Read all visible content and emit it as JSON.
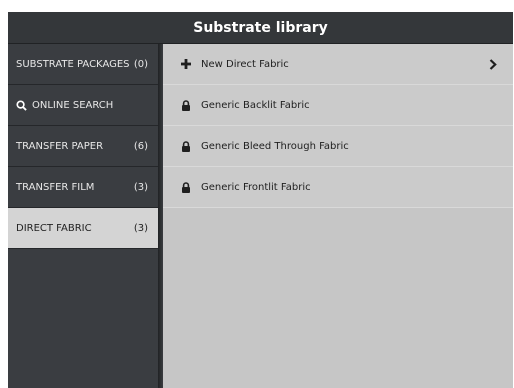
{
  "header": {
    "title": "Substrate library"
  },
  "sidebar": {
    "items": [
      {
        "label": "SUBSTRATE PACKAGES",
        "count": "(0)"
      },
      {
        "label": "ONLINE SEARCH",
        "icon": "search-icon",
        "count": ""
      },
      {
        "label": "TRANSFER PAPER",
        "count": "(6)"
      },
      {
        "label": "TRANSFER FILM",
        "count": "(3)"
      },
      {
        "label": "DIRECT FABRIC",
        "count": "(3)",
        "selected": true
      }
    ],
    "accent_color": "#1e9bdc"
  },
  "list": {
    "items": [
      {
        "label": "New Direct Fabric",
        "icon": "plus-icon",
        "trailing_icon": "chevron-right-icon"
      },
      {
        "label": "Generic Backlit Fabric",
        "icon": "lock-icon"
      },
      {
        "label": "Generic Bleed Through Fabric",
        "icon": "lock-icon"
      },
      {
        "label": "Generic Frontlit Fabric",
        "icon": "lock-icon"
      }
    ]
  }
}
